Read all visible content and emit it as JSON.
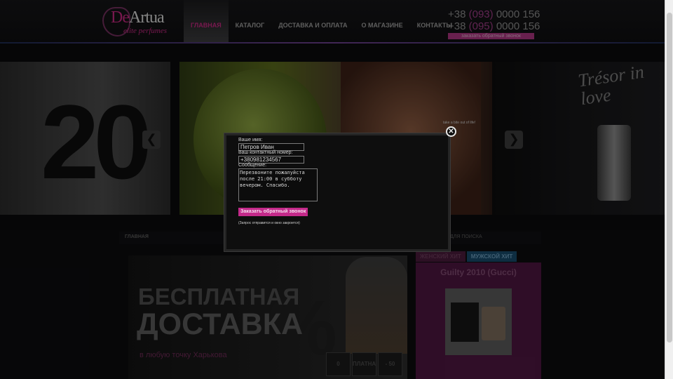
{
  "logo": {
    "name_highlight": "De",
    "name_rest": "Artua",
    "subtitle": "elite perfumes"
  },
  "nav": [
    {
      "label": "ГЛАВНАЯ",
      "active": true
    },
    {
      "label": "КАТАЛОГ",
      "active": false
    },
    {
      "label": "ДОСТАВКА И ОПЛАТА",
      "active": false
    },
    {
      "label": "О МАГАЗИНЕ",
      "active": false
    },
    {
      "label": "КОНТАКТЫ",
      "active": false
    }
  ],
  "phones": [
    {
      "prefix": "+38 ",
      "code": "(093)",
      "number": " 0000 156"
    },
    {
      "prefix": "+38 ",
      "code": "(095)",
      "number": " 0000 156"
    }
  ],
  "callback_button": "заказать обратный звонок",
  "slider": {
    "slide1_text": "20",
    "slide2_tagline": "take a bite out of life!",
    "slide3_script": "Trésor in love",
    "prev_arrow": "❮",
    "next_arrow": "❯"
  },
  "breadcrumb": "ГЛАВНАЯ",
  "search_hint": "ДЛЯ ПОИСКА",
  "banner": {
    "line1": "БЕСПЛАТНАЯ",
    "line2": "ДОСТАВКА",
    "line3": "в любую точку Харькова",
    "ghost": "%",
    "thumbs": [
      "0",
      "ПЛАТНАЯ ДОСТАВКА",
      "- 50"
    ]
  },
  "hits": {
    "tabs": [
      "ЖЕНСКИЙ ХИТ",
      "МУЖСКОЙ ХИТ"
    ],
    "product": "Guilty 2010 (Gucci)"
  },
  "modal": {
    "name_label": "Ваше имя:",
    "name_value": "Петров Иван",
    "phone_label": "Ваш контактный номер:",
    "phone_value": "+380981234567",
    "message_label": "Сообщение:",
    "message_value": "Перезвоните пожалуйста после 21:00 в субботу вечером. Спасибо.",
    "submit_label": "Заказать обратный звонок",
    "note": "(Запрос отправится и окно закроется)",
    "close_icon": "✕"
  },
  "colors": {
    "accent": "#c2287f",
    "modal_bg": "#0e0e0e",
    "tab_men": "#184a6a"
  }
}
